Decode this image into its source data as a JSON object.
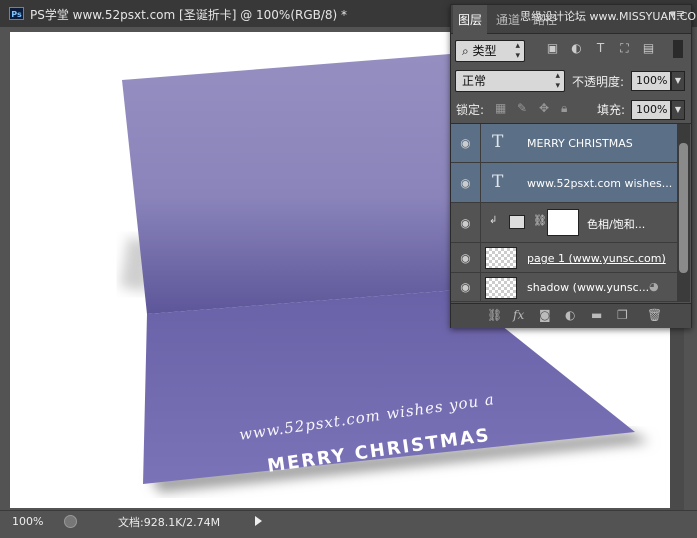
{
  "document": {
    "title": "PS学堂 www.52psxt.com [圣诞折卡] @ 100%(RGB/8) *",
    "app_badge": "Ps"
  },
  "card": {
    "line1": "www.52psxt.com wishes you a",
    "line2": "MERRY CHRISTMAS",
    "colors": {
      "top": "#948fc0",
      "fold": "#6a63a8",
      "bottom": "#7870b5"
    }
  },
  "status": {
    "zoom": "100%",
    "doc_info": "文档:928.1K/2.74M"
  },
  "layers_panel": {
    "tabs": [
      "图层",
      "通道",
      "路径"
    ],
    "active_tab": "图层",
    "filter_label": "类型",
    "blend_mode": "正常",
    "opacity_label": "不透明度:",
    "opacity_value": "100%",
    "lock_label": "锁定:",
    "fill_label": "填充:",
    "fill_value": "100%",
    "layers": [
      {
        "name": "MERRY CHRISTMAS",
        "kind": "text",
        "selected": true
      },
      {
        "name": "www.52psxt.com wishes...",
        "kind": "text",
        "selected": true
      },
      {
        "name": "色相/饱和...",
        "kind": "adjustment",
        "selected": false
      },
      {
        "name": "page 1 (www.yunsc.com)",
        "kind": "smart",
        "selected": false
      },
      {
        "name": "shadow (www.yunsc...",
        "kind": "smart",
        "selected": false
      }
    ]
  },
  "watermark": "思缘设计论坛 www.MISSYUAN.COM"
}
